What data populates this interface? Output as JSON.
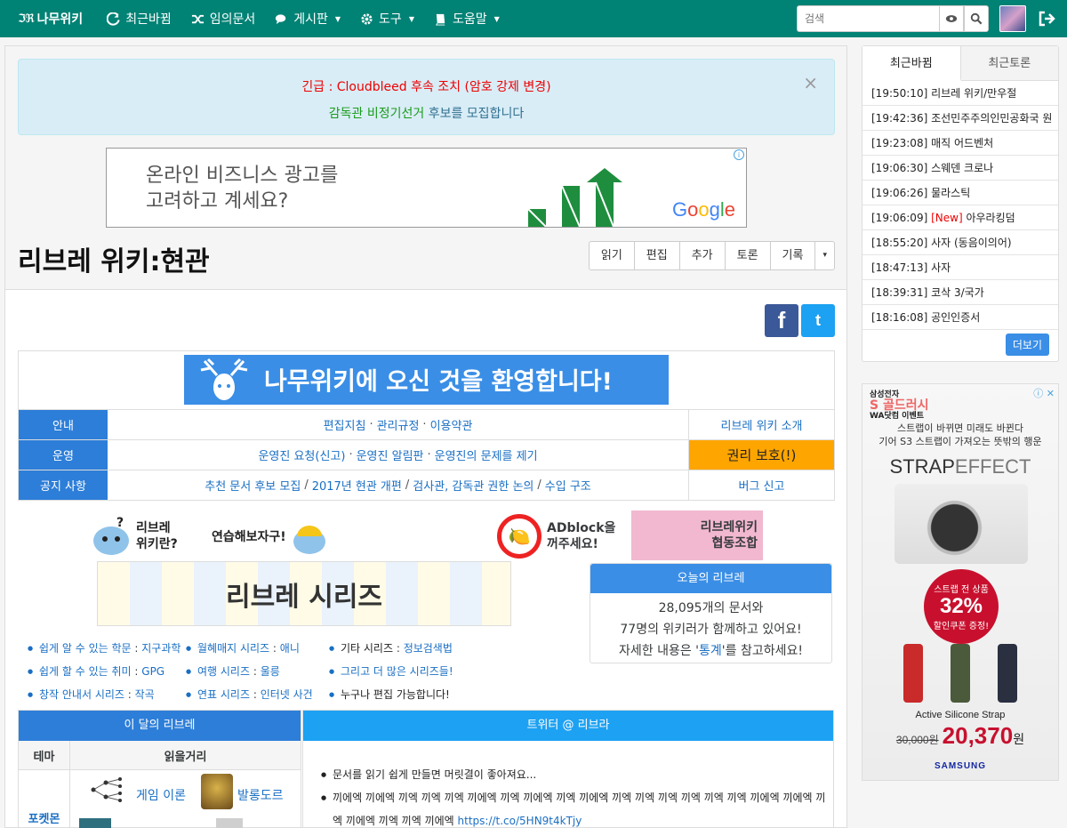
{
  "navbar": {
    "brand": "나무위키",
    "brand_mark": "ℑℜ",
    "items": [
      {
        "label": "최근바뀜",
        "icon": "refresh-icon",
        "caret": false
      },
      {
        "label": "임의문서",
        "icon": "random-icon",
        "caret": false
      },
      {
        "label": "게시판",
        "icon": "comments-icon",
        "caret": true
      },
      {
        "label": "도구",
        "icon": "gear-icon",
        "caret": true
      },
      {
        "label": "도움말",
        "icon": "book-icon",
        "caret": true
      }
    ],
    "search_placeholder": "검색",
    "colors": {
      "bar": "#008275"
    }
  },
  "alert": {
    "line1": "긴급 : Cloudbleed 후속 조치 (암호 강제 변경)",
    "line2_green": "감독관 비정기선거",
    "line2_rest": " 후보를 모집합니다",
    "close": "×"
  },
  "top_ad": {
    "line1": "온라인 비즈니스 광고를",
    "line2": "고려하고 계세요?",
    "brand": "Google",
    "info": "i"
  },
  "page": {
    "title": "리브레 위키:현관",
    "actions": [
      "읽기",
      "편집",
      "추가",
      "토론",
      "기록"
    ],
    "more_caret": "▾"
  },
  "share": {
    "facebook": "f",
    "twitter": "t"
  },
  "welcome": {
    "banner_n": "나무위키",
    "banner_rest": "에 오신 것을 환영합니다!",
    "rows": [
      {
        "head": "안내",
        "links": [
          "편집지침",
          "관리규정",
          "이용약관"
        ],
        "sep": "·",
        "right": "리브레 위키 소개"
      },
      {
        "head": "운영",
        "links": [
          "운영진 요청(신고)",
          "운영진 알림판",
          "운영진의 문제를 제기"
        ],
        "sep": "·",
        "right": "권리 보호(!)"
      },
      {
        "head": "공지 사항",
        "links": [
          "추천 문서 후보 모집",
          "2017년 현관 개편",
          "검사관, 감독관 권한 논의",
          "수입 구조"
        ],
        "sep": "/",
        "right": "버그 신고"
      }
    ]
  },
  "mascots": {
    "what": "리브레\n위키란?",
    "practice": "연습해보자구!",
    "series": "리브레 시리즈",
    "adblock": "ADblock을\n꺼주세요!",
    "collab": "리브레위키\n협동조합"
  },
  "today": {
    "header": "오늘의 리브레",
    "docs": "28,095개의 문서와",
    "editors": "77명의 위키러가 함께하고 있어요!",
    "more_pre": "자세한 내용은 '",
    "more_link": "통계",
    "more_post": "'를 참고하세요!"
  },
  "series_cols": [
    [
      {
        "label": "쉽게 알 수 있는 학문",
        "val": "지구과학"
      },
      {
        "label": "쉽게 할 수 있는 취미",
        "val": "GPG"
      },
      {
        "label": "창작 안내서 시리즈",
        "val": "작곡"
      }
    ],
    [
      {
        "label": "월혜매지 시리즈",
        "val": "애니"
      },
      {
        "label": "여행 시리즈",
        "val": "울릉"
      },
      {
        "label": "연표 시리즈",
        "val": "인터넷 사건"
      }
    ],
    [
      {
        "label": "기타 시리즈",
        "val": "정보검색법",
        "plain": true
      },
      {
        "label": "그리고 더 많은 시리즈들!",
        "val": ""
      },
      {
        "label": "누구나 편집 가능합니다!",
        "val": "",
        "plain": true
      }
    ]
  ],
  "month": {
    "header": "이 달의 리브레",
    "col1": "테마",
    "col2": "읽을거리",
    "row_label": "포켓몬",
    "link1": "게임 이론",
    "link2": "발롱도르"
  },
  "twitter_panel": {
    "header": "트위터 @ 리브라",
    "tweet1": "문서를 읽기 쉽게 만들면 머릿결이 좋아져요...",
    "tweet2": "끼에엑 끼에엑 끼엑 끼엑 끼엑 끼에엑 끼엑 끼에엑 끼엑 끼에엑 끼엑 끼엑 끼엑 끼엑 끼엑 끼엑 끼에엑 끼에엑 끼엑 끼에엑 끼엑 끼엑 끼에엑 ",
    "tweet2_link": "https://t.co/5HN9t4kTjy"
  },
  "sidebar": {
    "tabs": [
      "최근바뀜",
      "최근토론"
    ],
    "recent": [
      {
        "time": "[19:50:10]",
        "title": "리브레 위키/만우절",
        "new": ""
      },
      {
        "time": "[19:42:36]",
        "title": "조선민주주의인민공화국 원",
        "new": ""
      },
      {
        "time": "[19:23:08]",
        "title": "매직 어드벤처",
        "new": ""
      },
      {
        "time": "[19:06:30]",
        "title": "스웨덴 크로나",
        "new": ""
      },
      {
        "time": "[19:06:26]",
        "title": "물라스틱",
        "new": ""
      },
      {
        "time": "[19:06:09]",
        "title": "아우라킹덤",
        "new": "[New]"
      },
      {
        "time": "[18:55:20]",
        "title": "사자 (동음이의어)",
        "new": ""
      },
      {
        "time": "[18:47:13]",
        "title": "사자",
        "new": ""
      },
      {
        "time": "[18:39:31]",
        "title": "코삭 3/국가",
        "new": ""
      },
      {
        "time": "[18:16:08]",
        "title": "공인인증서",
        "new": ""
      }
    ],
    "more": "더보기"
  },
  "side_ad": {
    "store1": "삼성전자",
    "store2": "S 골드러시",
    "store3": "WA닷컴 이벤트",
    "sub1": "스트랩이 바뀌면 미래도 바뀐다",
    "sub2": "기어 S3 스트랩이 가져오는 뜻밖의 행운",
    "brand_a": "STRAP",
    "brand_b": "EFFECT",
    "disc_a": "스트랩 전 상품",
    "disc_b": "32%",
    "disc_c": "할인쿠폰 증정!",
    "caption": "Active Silicone Strap",
    "old_price": "30,000원",
    "new_price": "20,370",
    "won": "원",
    "maker": "SAMSUNG",
    "icons": "ⓘ ✕"
  }
}
